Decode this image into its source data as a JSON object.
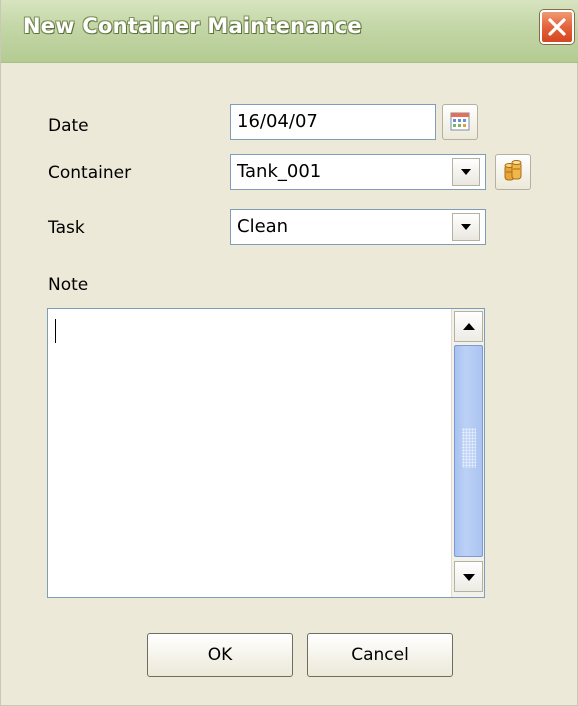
{
  "window": {
    "title": "New Container Maintenance"
  },
  "form": {
    "date": {
      "label": "Date",
      "value": "16/04/07"
    },
    "container": {
      "label": "Container",
      "value": "Tank_001"
    },
    "task": {
      "label": "Task",
      "value": "Clean"
    },
    "note": {
      "label": "Note",
      "value": ""
    }
  },
  "buttons": {
    "ok": "OK",
    "cancel": "Cancel"
  },
  "icons": {
    "close": "close-icon",
    "calendar": "calendar-icon",
    "container_lookup": "barrels-icon",
    "dropdown": "chevron-down-icon",
    "scroll_up": "arrow-up-icon",
    "scroll_down": "arrow-down-icon"
  },
  "colors": {
    "titlebar": "#c3d6a6",
    "dialog_background": "#ece9d8",
    "close_button": "#e4633b",
    "scrollbar_thumb": "#aac4f1",
    "field_border": "#7f9db9"
  }
}
